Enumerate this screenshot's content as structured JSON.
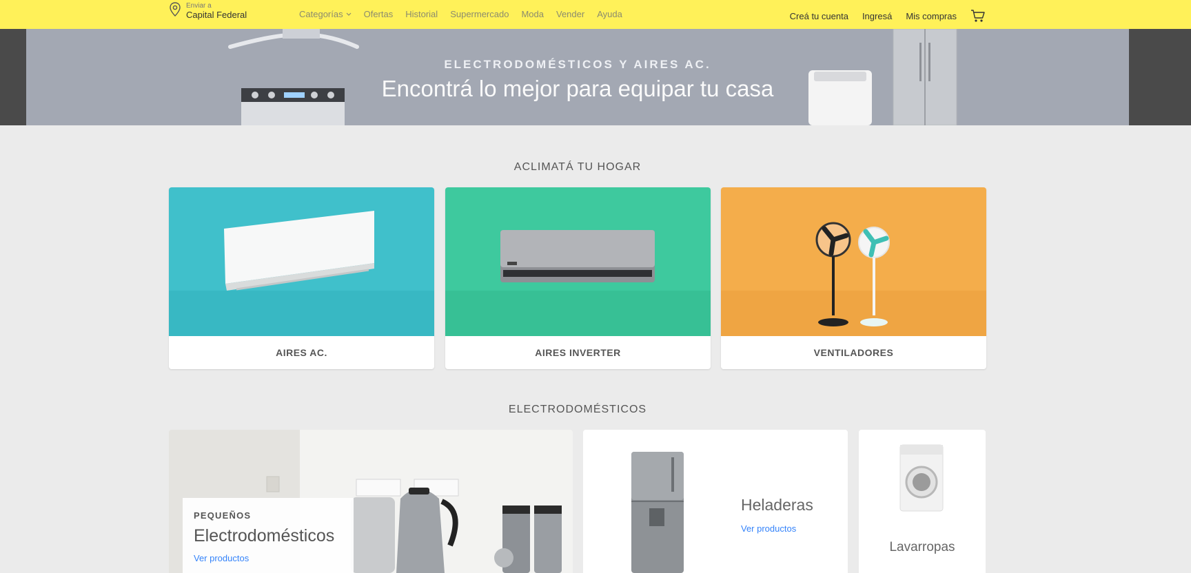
{
  "header": {
    "location_label": "Enviar a",
    "location_value": "Capital Federal",
    "nav": [
      {
        "label": "Categorías"
      },
      {
        "label": "Ofertas"
      },
      {
        "label": "Historial"
      },
      {
        "label": "Supermercado"
      },
      {
        "label": "Moda"
      },
      {
        "label": "Vender"
      },
      {
        "label": "Ayuda"
      }
    ],
    "account": {
      "create": "Creá tu cuenta",
      "login": "Ingresá",
      "purchases": "Mis compras"
    }
  },
  "hero": {
    "kicker": "ELECTRODOMÉSTICOS Y AIRES AC.",
    "headline": "Encontrá lo mejor para equipar tu casa"
  },
  "climate": {
    "title": "ACLIMATÁ TU HOGAR",
    "cards": [
      {
        "label": "AIRES AC.",
        "color": "#40c0cb"
      },
      {
        "label": "AIRES INVERTER",
        "color": "#3ec99e"
      },
      {
        "label": "VENTILADORES",
        "color": "#f4ad4b"
      }
    ]
  },
  "appliances": {
    "title": "ELECTRODOMÉSTICOS",
    "small": {
      "pre": "PEQUEÑOS",
      "title": "Electrodomésticos",
      "link": "Ver productos"
    },
    "fridge": {
      "title": "Heladeras",
      "link": "Ver productos"
    },
    "washer": {
      "title": "Lavarropas"
    }
  },
  "colors": {
    "header_bg": "#fff159",
    "link": "#3483fa"
  }
}
